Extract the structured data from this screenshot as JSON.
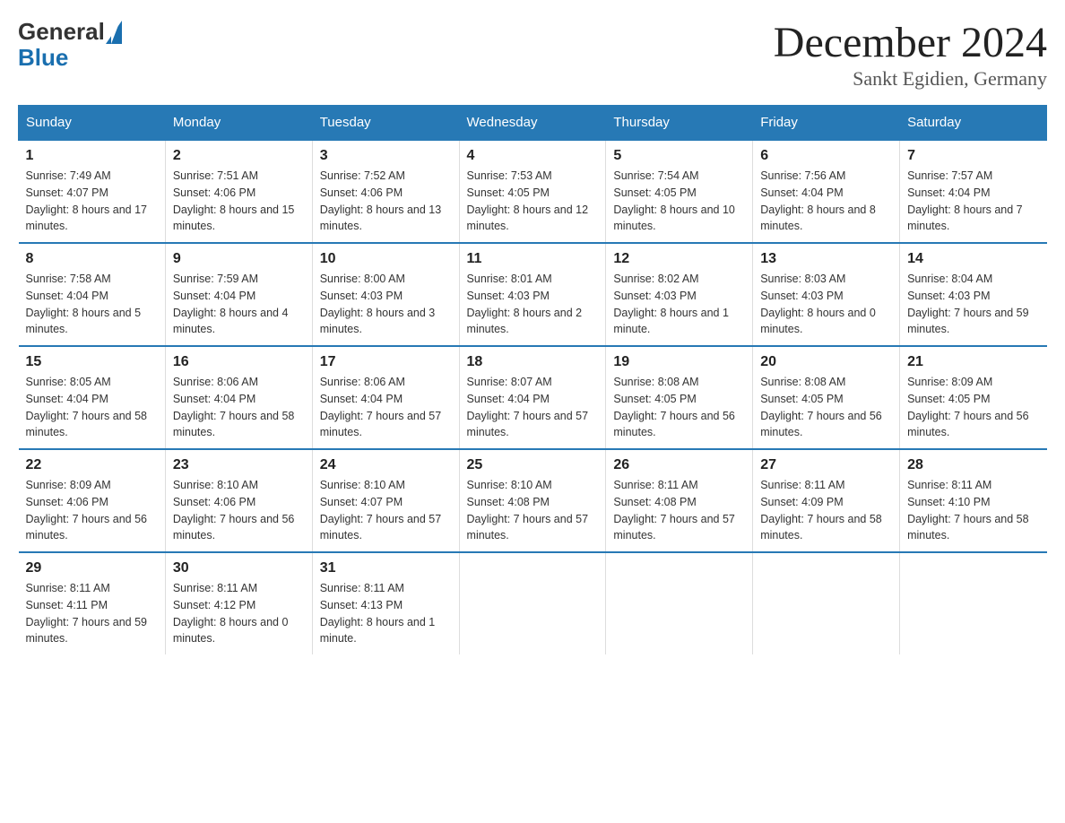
{
  "header": {
    "logo_general": "General",
    "logo_blue": "Blue",
    "month_title": "December 2024",
    "location": "Sankt Egidien, Germany"
  },
  "days_of_week": [
    "Sunday",
    "Monday",
    "Tuesday",
    "Wednesday",
    "Thursday",
    "Friday",
    "Saturday"
  ],
  "weeks": [
    [
      {
        "day": "1",
        "sunrise": "7:49 AM",
        "sunset": "4:07 PM",
        "daylight": "8 hours and 17 minutes."
      },
      {
        "day": "2",
        "sunrise": "7:51 AM",
        "sunset": "4:06 PM",
        "daylight": "8 hours and 15 minutes."
      },
      {
        "day": "3",
        "sunrise": "7:52 AM",
        "sunset": "4:06 PM",
        "daylight": "8 hours and 13 minutes."
      },
      {
        "day": "4",
        "sunrise": "7:53 AM",
        "sunset": "4:05 PM",
        "daylight": "8 hours and 12 minutes."
      },
      {
        "day": "5",
        "sunrise": "7:54 AM",
        "sunset": "4:05 PM",
        "daylight": "8 hours and 10 minutes."
      },
      {
        "day": "6",
        "sunrise": "7:56 AM",
        "sunset": "4:04 PM",
        "daylight": "8 hours and 8 minutes."
      },
      {
        "day": "7",
        "sunrise": "7:57 AM",
        "sunset": "4:04 PM",
        "daylight": "8 hours and 7 minutes."
      }
    ],
    [
      {
        "day": "8",
        "sunrise": "7:58 AM",
        "sunset": "4:04 PM",
        "daylight": "8 hours and 5 minutes."
      },
      {
        "day": "9",
        "sunrise": "7:59 AM",
        "sunset": "4:04 PM",
        "daylight": "8 hours and 4 minutes."
      },
      {
        "day": "10",
        "sunrise": "8:00 AM",
        "sunset": "4:03 PM",
        "daylight": "8 hours and 3 minutes."
      },
      {
        "day": "11",
        "sunrise": "8:01 AM",
        "sunset": "4:03 PM",
        "daylight": "8 hours and 2 minutes."
      },
      {
        "day": "12",
        "sunrise": "8:02 AM",
        "sunset": "4:03 PM",
        "daylight": "8 hours and 1 minute."
      },
      {
        "day": "13",
        "sunrise": "8:03 AM",
        "sunset": "4:03 PM",
        "daylight": "8 hours and 0 minutes."
      },
      {
        "day": "14",
        "sunrise": "8:04 AM",
        "sunset": "4:03 PM",
        "daylight": "7 hours and 59 minutes."
      }
    ],
    [
      {
        "day": "15",
        "sunrise": "8:05 AM",
        "sunset": "4:04 PM",
        "daylight": "7 hours and 58 minutes."
      },
      {
        "day": "16",
        "sunrise": "8:06 AM",
        "sunset": "4:04 PM",
        "daylight": "7 hours and 58 minutes."
      },
      {
        "day": "17",
        "sunrise": "8:06 AM",
        "sunset": "4:04 PM",
        "daylight": "7 hours and 57 minutes."
      },
      {
        "day": "18",
        "sunrise": "8:07 AM",
        "sunset": "4:04 PM",
        "daylight": "7 hours and 57 minutes."
      },
      {
        "day": "19",
        "sunrise": "8:08 AM",
        "sunset": "4:05 PM",
        "daylight": "7 hours and 56 minutes."
      },
      {
        "day": "20",
        "sunrise": "8:08 AM",
        "sunset": "4:05 PM",
        "daylight": "7 hours and 56 minutes."
      },
      {
        "day": "21",
        "sunrise": "8:09 AM",
        "sunset": "4:05 PM",
        "daylight": "7 hours and 56 minutes."
      }
    ],
    [
      {
        "day": "22",
        "sunrise": "8:09 AM",
        "sunset": "4:06 PM",
        "daylight": "7 hours and 56 minutes."
      },
      {
        "day": "23",
        "sunrise": "8:10 AM",
        "sunset": "4:06 PM",
        "daylight": "7 hours and 56 minutes."
      },
      {
        "day": "24",
        "sunrise": "8:10 AM",
        "sunset": "4:07 PM",
        "daylight": "7 hours and 57 minutes."
      },
      {
        "day": "25",
        "sunrise": "8:10 AM",
        "sunset": "4:08 PM",
        "daylight": "7 hours and 57 minutes."
      },
      {
        "day": "26",
        "sunrise": "8:11 AM",
        "sunset": "4:08 PM",
        "daylight": "7 hours and 57 minutes."
      },
      {
        "day": "27",
        "sunrise": "8:11 AM",
        "sunset": "4:09 PM",
        "daylight": "7 hours and 58 minutes."
      },
      {
        "day": "28",
        "sunrise": "8:11 AM",
        "sunset": "4:10 PM",
        "daylight": "7 hours and 58 minutes."
      }
    ],
    [
      {
        "day": "29",
        "sunrise": "8:11 AM",
        "sunset": "4:11 PM",
        "daylight": "7 hours and 59 minutes."
      },
      {
        "day": "30",
        "sunrise": "8:11 AM",
        "sunset": "4:12 PM",
        "daylight": "8 hours and 0 minutes."
      },
      {
        "day": "31",
        "sunrise": "8:11 AM",
        "sunset": "4:13 PM",
        "daylight": "8 hours and 1 minute."
      },
      null,
      null,
      null,
      null
    ]
  ]
}
